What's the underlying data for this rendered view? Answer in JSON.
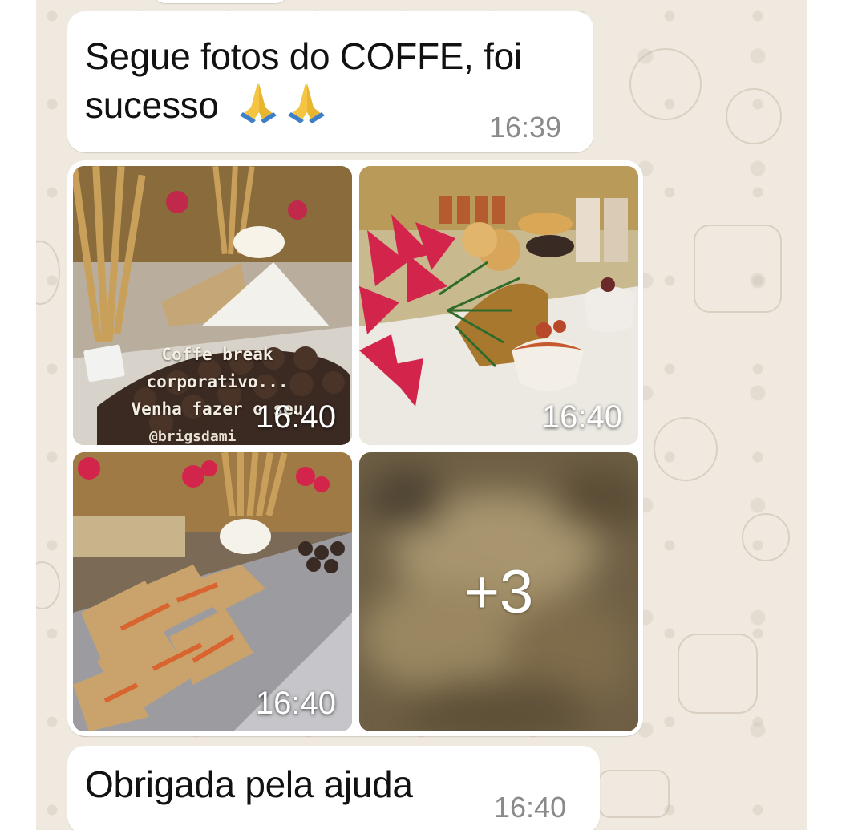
{
  "conversation": {
    "messages": [
      {
        "text_line1": "Segue fotos do COFFE, foi",
        "text_line2": "sucesso",
        "emoji": "🙏🙏",
        "time": "16:39"
      },
      {
        "photos": [
          {
            "time": "16:40",
            "overlay_line1": "Coffe break",
            "overlay_line2": "corporativo...",
            "overlay_line3": "Venha fazer o seu",
            "overlay_handle": "@brigsdami"
          },
          {
            "time": "16:40"
          },
          {
            "time": "16:40"
          },
          {
            "more": "+3"
          }
        ]
      },
      {
        "text": "Obrigada pela ajuda",
        "time": "16:40"
      }
    ]
  },
  "colors": {
    "wallpaper": "#efe9df",
    "bubble": "#ffffff",
    "timestamp": "#8a8a8a"
  }
}
